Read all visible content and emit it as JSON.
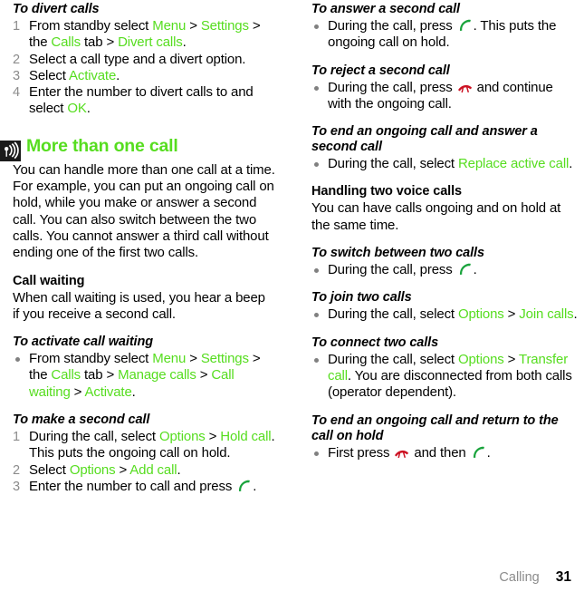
{
  "colors": {
    "link_green": "#56dd1f",
    "step_number_gray": "#8c8c8c",
    "call_key_green": "#19a33c",
    "end_key_red": "#cc1122",
    "note_icon_bg": "#1b1b1b"
  },
  "footer": {
    "chapter": "Calling",
    "page_number": "31"
  },
  "left_column": {
    "divert_calls": {
      "heading": "To divert calls",
      "steps": [
        {
          "number": "1",
          "parts": [
            {
              "t": "From standby select ",
              "s": "plain"
            },
            {
              "t": "Menu",
              "s": "green"
            },
            {
              "t": " > ",
              "s": "plain"
            },
            {
              "t": "Settings",
              "s": "green"
            },
            {
              "t": " > the ",
              "s": "plain"
            },
            {
              "t": "Calls",
              "s": "green"
            },
            {
              "t": " tab > ",
              "s": "plain"
            },
            {
              "t": "Divert calls",
              "s": "green"
            },
            {
              "t": ".",
              "s": "plain"
            }
          ]
        },
        {
          "number": "2",
          "parts": [
            {
              "t": "Select a call type and a divert option.",
              "s": "plain"
            }
          ]
        },
        {
          "number": "3",
          "parts": [
            {
              "t": "Select ",
              "s": "plain"
            },
            {
              "t": "Activate",
              "s": "green"
            },
            {
              "t": ".",
              "s": "plain"
            }
          ]
        },
        {
          "number": "4",
          "parts": [
            {
              "t": "Enter the number to divert calls to and select ",
              "s": "plain"
            },
            {
              "t": "OK",
              "s": "green"
            },
            {
              "t": ".",
              "s": "plain"
            }
          ]
        }
      ]
    },
    "more_than_one_call": {
      "icon": "note-antenna-icon",
      "title": "More than one call",
      "body": "You can handle more than one call at a time. For example, you can put an ongoing call on hold, while you make or answer a second call. You can also switch between the two calls. You cannot answer a third call without ending one of the first two calls."
    },
    "call_waiting": {
      "heading": "Call waiting",
      "body": "When call waiting is used, you hear a beep if you receive a second call."
    },
    "activate_call_waiting": {
      "heading": "To activate call waiting",
      "bullets": [
        {
          "parts": [
            {
              "t": "From standby select ",
              "s": "plain"
            },
            {
              "t": "Menu",
              "s": "green"
            },
            {
              "t": " > ",
              "s": "plain"
            },
            {
              "t": "Settings",
              "s": "green"
            },
            {
              "t": " > the ",
              "s": "plain"
            },
            {
              "t": "Calls",
              "s": "green"
            },
            {
              "t": " tab > ",
              "s": "plain"
            },
            {
              "t": "Manage calls",
              "s": "green"
            },
            {
              "t": " > ",
              "s": "plain"
            },
            {
              "t": "Call waiting",
              "s": "green"
            },
            {
              "t": " > ",
              "s": "plain"
            },
            {
              "t": "Activate",
              "s": "green"
            },
            {
              "t": ".",
              "s": "plain"
            }
          ]
        }
      ]
    },
    "make_second_call": {
      "heading": "To make a second call",
      "steps": [
        {
          "number": "1",
          "parts": [
            {
              "t": "During the call, select ",
              "s": "plain"
            },
            {
              "t": "Options",
              "s": "green"
            },
            {
              "t": " > ",
              "s": "plain"
            },
            {
              "t": "Hold call",
              "s": "green"
            },
            {
              "t": ". This puts the ongoing call on hold.",
              "s": "plain"
            }
          ]
        },
        {
          "number": "2",
          "parts": [
            {
              "t": "Select ",
              "s": "plain"
            },
            {
              "t": "Options",
              "s": "green"
            },
            {
              "t": " > ",
              "s": "plain"
            },
            {
              "t": "Add call",
              "s": "green"
            },
            {
              "t": ".",
              "s": "plain"
            }
          ]
        },
        {
          "number": "3",
          "parts": [
            {
              "t": "Enter the number to call and press ",
              "s": "plain"
            },
            {
              "t": "",
              "s": "call-key-icon"
            },
            {
              "t": ".",
              "s": "plain"
            }
          ]
        }
      ]
    }
  },
  "right_column": {
    "answer_second_call": {
      "heading": "To answer a second call",
      "bullets": [
        {
          "parts": [
            {
              "t": "During the call, press ",
              "s": "plain"
            },
            {
              "t": "",
              "s": "call-key-icon"
            },
            {
              "t": ". This puts the ongoing call on hold.",
              "s": "plain"
            }
          ]
        }
      ]
    },
    "reject_second_call": {
      "heading": "To reject a second call",
      "bullets": [
        {
          "parts": [
            {
              "t": "During the call, press ",
              "s": "plain"
            },
            {
              "t": "",
              "s": "end-key-icon"
            },
            {
              "t": " and continue with the ongoing call.",
              "s": "plain"
            }
          ]
        }
      ]
    },
    "end_and_answer": {
      "heading": "To end an ongoing call and answer a second call",
      "bullets": [
        {
          "parts": [
            {
              "t": "During the call, select ",
              "s": "plain"
            },
            {
              "t": "Replace active call",
              "s": "green"
            },
            {
              "t": ".",
              "s": "plain"
            }
          ]
        }
      ]
    },
    "handling_two_voice_calls": {
      "heading": "Handling two voice calls",
      "body": "You can have calls ongoing and on hold at the same time."
    },
    "switch_between": {
      "heading": "To switch between two calls",
      "bullets": [
        {
          "parts": [
            {
              "t": "During the call, press ",
              "s": "plain"
            },
            {
              "t": "",
              "s": "call-key-icon"
            },
            {
              "t": ".",
              "s": "plain"
            }
          ]
        }
      ]
    },
    "join_two_calls": {
      "heading": "To join two calls",
      "bullets": [
        {
          "parts": [
            {
              "t": "During the call, select ",
              "s": "plain"
            },
            {
              "t": "Options",
              "s": "green"
            },
            {
              "t": " > ",
              "s": "plain"
            },
            {
              "t": "Join calls",
              "s": "green"
            },
            {
              "t": ".",
              "s": "plain"
            }
          ]
        }
      ]
    },
    "connect_two_calls": {
      "heading": "To connect two calls",
      "bullets": [
        {
          "parts": [
            {
              "t": "During the call, select ",
              "s": "plain"
            },
            {
              "t": "Options",
              "s": "green"
            },
            {
              "t": " > ",
              "s": "plain"
            },
            {
              "t": "Transfer call",
              "s": "green"
            },
            {
              "t": ". You are disconnected from both calls (operator dependent).",
              "s": "plain"
            }
          ]
        }
      ]
    },
    "end_and_return": {
      "heading": "To end an ongoing call and return to the call on hold",
      "bullets": [
        {
          "parts": [
            {
              "t": "First press ",
              "s": "plain"
            },
            {
              "t": "",
              "s": "end-key-icon"
            },
            {
              "t": " and then ",
              "s": "plain"
            },
            {
              "t": "",
              "s": "call-key-icon"
            },
            {
              "t": ".",
              "s": "plain"
            }
          ]
        }
      ]
    }
  }
}
